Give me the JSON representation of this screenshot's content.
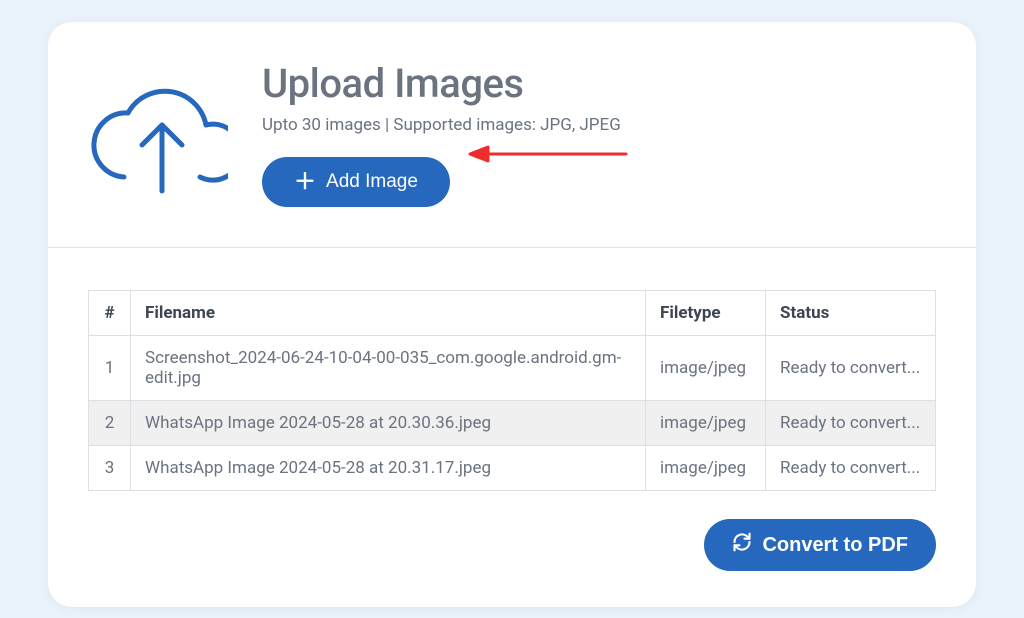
{
  "header": {
    "title": "Upload Images",
    "subtitle": "Upto 30 images | Supported images: JPG, JPEG",
    "add_button_label": "Add Image"
  },
  "table": {
    "columns": {
      "idx": "#",
      "filename": "Filename",
      "filetype": "Filetype",
      "status": "Status"
    },
    "rows": [
      {
        "idx": "1",
        "filename": "Screenshot_2024-06-24-10-04-00-035_com.google.android.gm-edit.jpg",
        "filetype": "image/jpeg",
        "status": "Ready to convert..."
      },
      {
        "idx": "2",
        "filename": "WhatsApp Image 2024-05-28 at 20.30.36.jpeg",
        "filetype": "image/jpeg",
        "status": "Ready to convert..."
      },
      {
        "idx": "3",
        "filename": "WhatsApp Image 2024-05-28 at 20.31.17.jpeg",
        "filetype": "image/jpeg",
        "status": "Ready to convert..."
      }
    ]
  },
  "actions": {
    "convert_label": "Convert to PDF"
  },
  "colors": {
    "primary": "#2568bd",
    "text_muted": "#6b7380",
    "annotation_red": "#ef2d2d"
  }
}
